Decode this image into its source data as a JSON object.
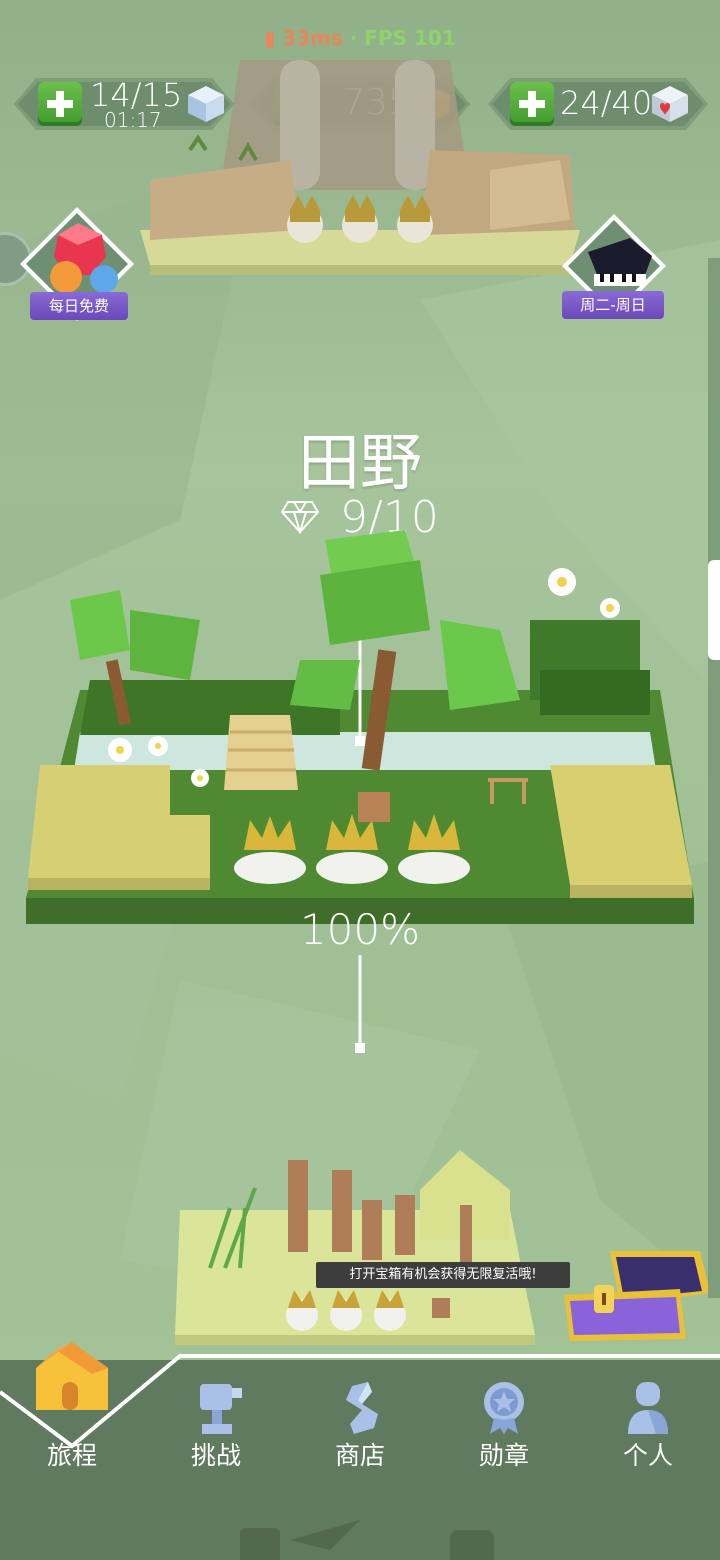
{
  "status": {
    "latency": "33ms",
    "separator": "·",
    "fps": "FPS 101"
  },
  "hud": {
    "energy": {
      "value": "14/15",
      "timer": "01:17"
    },
    "gold": {
      "value": "735"
    },
    "hearts": {
      "value": "24/40"
    }
  },
  "badges": {
    "daily": "每日免费",
    "weekly": "周二-周日"
  },
  "level": {
    "title": "田野",
    "gems": "9/10",
    "progress": "100%"
  },
  "tooltip": "打开宝箱有机会获得无限复活哦!",
  "nav": [
    {
      "label": "旅程",
      "icon": "home-icon"
    },
    {
      "label": "挑战",
      "icon": "trophy-icon"
    },
    {
      "label": "商店",
      "icon": "shop-icon"
    },
    {
      "label": "勋章",
      "icon": "medal-icon"
    },
    {
      "label": "个人",
      "icon": "person-icon"
    }
  ],
  "colors": {
    "accent_green": "#4caf36",
    "bg": "#9dba92",
    "nav": "#5f7a5f",
    "purple": "#7a58c8"
  }
}
